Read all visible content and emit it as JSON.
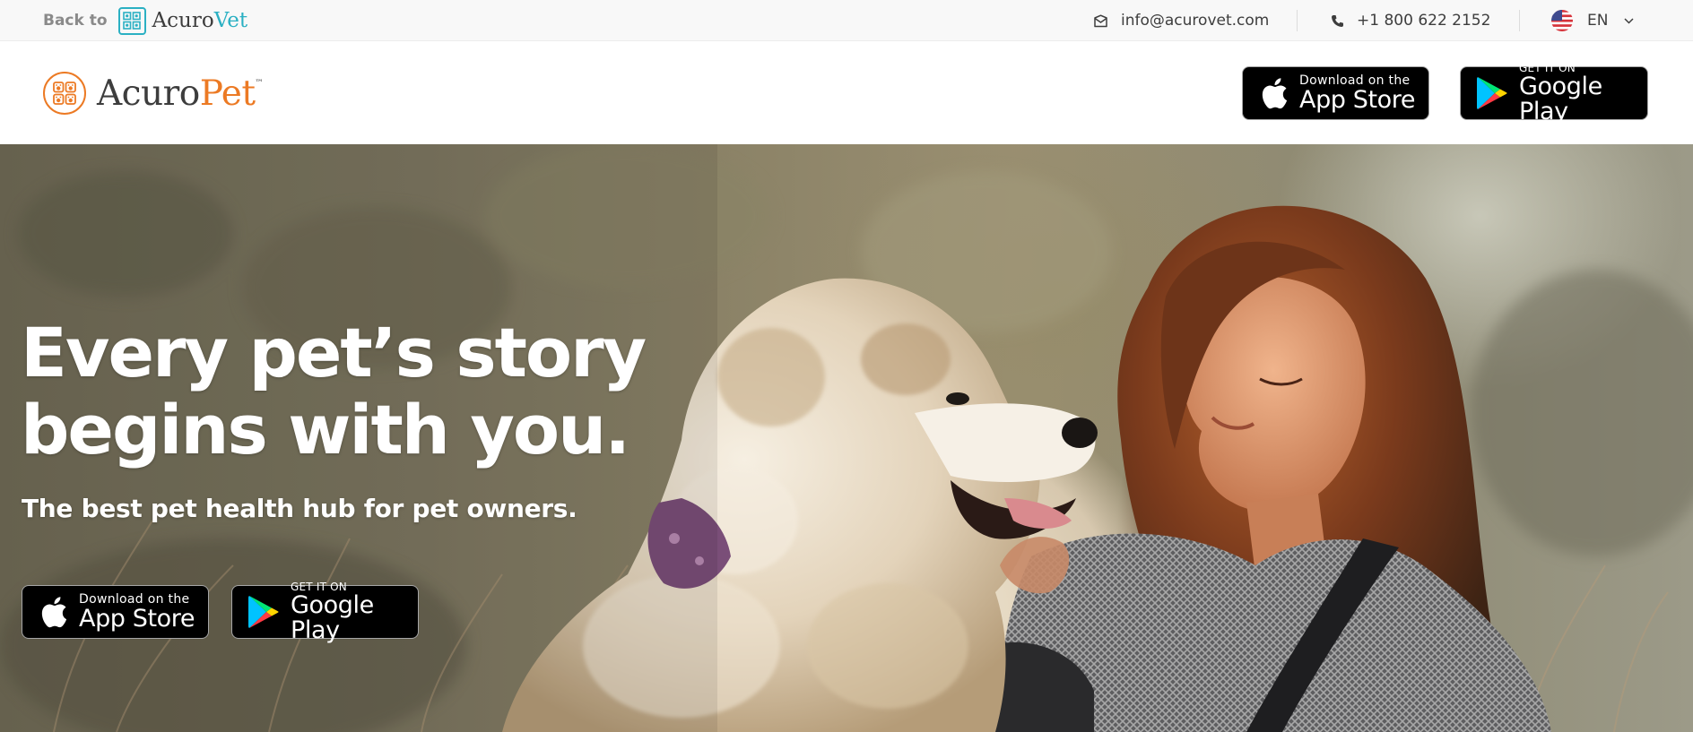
{
  "topbar": {
    "back_label": "Back to",
    "vet_brand_main": "Acuro",
    "vet_brand_accent": "Vet",
    "email": "info@acurovet.com",
    "phone": "+1 800 622 2152",
    "language": "EN"
  },
  "header": {
    "brand_main": "Acuro",
    "brand_accent": "Pet",
    "brand_tm": "™"
  },
  "badges": {
    "apple_small": "Download on the",
    "apple_big": "App Store",
    "google_small": "GET IT ON",
    "google_big": "Google Play"
  },
  "hero": {
    "title_line1": "Every pet’s story",
    "title_line2": "begins with you.",
    "subtitle": "The best pet health hub for pet owners."
  },
  "colors": {
    "pet_accent": "#ec7a24",
    "vet_accent": "#2bb0c3",
    "badge_bg": "#000000"
  },
  "icons": [
    "mail-icon",
    "phone-icon",
    "us-flag-icon",
    "chevron-down-icon",
    "apple-icon",
    "google-play-icon",
    "paw-logo-icon"
  ]
}
